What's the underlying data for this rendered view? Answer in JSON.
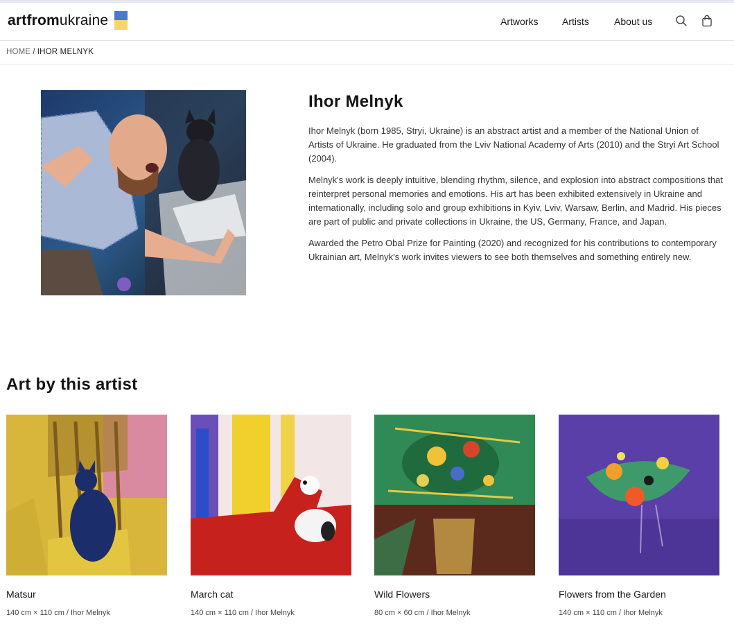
{
  "colors": {
    "flag_blue": "#4a7ad0",
    "flag_yellow": "#f5d66a",
    "divider": "#e3e3e3"
  },
  "header": {
    "logo": {
      "bold": "artfrom",
      "light": "ukraine"
    },
    "nav": [
      {
        "label": "Artworks"
      },
      {
        "label": "Artists"
      },
      {
        "label": "About us"
      }
    ],
    "icons": [
      "search-icon",
      "shopping-bag-icon"
    ]
  },
  "breadcrumb": {
    "home": "HOME",
    "separator": "/",
    "current": "IHOR MELNYK"
  },
  "artist": {
    "name": "Ihor Melnyk",
    "bio": [
      "Ihor Melnyk (born 1985, Stryi, Ukraine) is an abstract artist and a member of the National Union of Artists of Ukraine. He graduated from the Lviv National Academy of Arts (2010) and the Stryi Art School (2004).",
      "Melnyk's work is deeply intuitive, blending rhythm, silence, and explosion into abstract compositions that reinterpret personal memories and emotions. His art has been exhibited extensively in Ukraine and internationally, including solo and group exhibitions in Kyiv, Lviv, Warsaw, Berlin, and Madrid. His pieces are part of public and private collections in Ukraine, the US, Germany, France, and Japan.",
      "Awarded the Petro Obal Prize for Painting (2020) and recognized for his contributions to contemporary Ukrainian art, Melnyk's work invites viewers to see both themselves and something entirely new."
    ]
  },
  "artworks_section": {
    "title": "Art by this artist",
    "items": [
      {
        "title": "Matsur",
        "meta": "140 cm × 110 cm / Ihor Melnyk"
      },
      {
        "title": "March cat",
        "meta": "140 cm × 110 cm / Ihor Melnyk"
      },
      {
        "title": "Wild Flowers",
        "meta": "80 cm × 60 cm / Ihor Melnyk"
      },
      {
        "title": "Flowers from the Garden",
        "meta": "140 cm × 110 cm / Ihor Melnyk"
      }
    ]
  }
}
